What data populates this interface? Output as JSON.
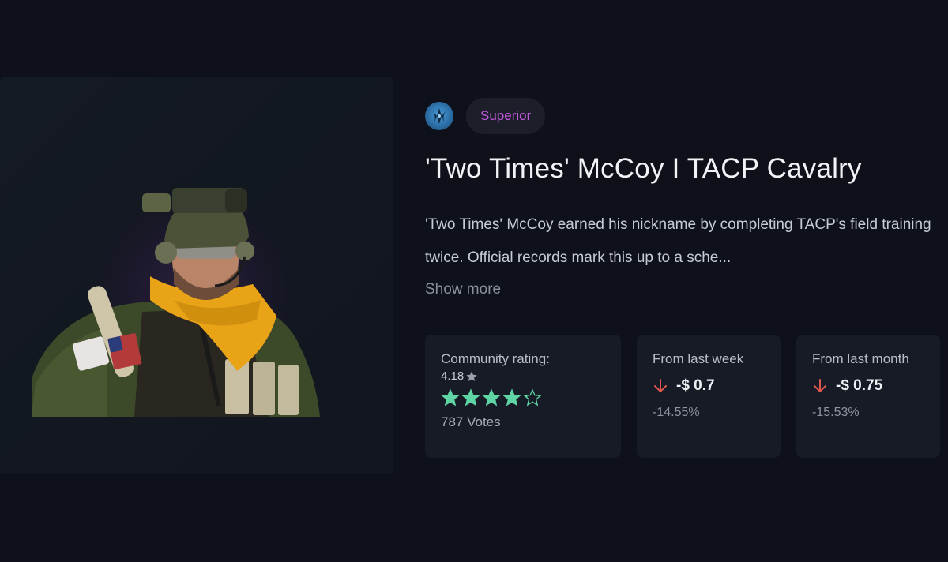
{
  "item": {
    "rarity": "Superior",
    "name": "'Two Times' McCoy I TACP Cavalry",
    "description": "'Two Times' McCoy earned his nickname by completing TACP's field training twice. Official records mark this up to a sche...",
    "show_more_label": "Show more",
    "faction_icon": "faction-emblem-icon"
  },
  "stats": {
    "rating": {
      "label": "Community rating:",
      "score": "4.18",
      "stars_value": 4.18,
      "votes": "787 Votes"
    },
    "week": {
      "label": "From last week",
      "value": "-$ 0.7",
      "percent": "-14.55%"
    },
    "month": {
      "label": "From last month",
      "value": "-$ 0.75",
      "percent": "-15.53%"
    }
  },
  "colors": {
    "background": "#0f111a",
    "rarity": "#c658e0",
    "star": "#5fd4a4",
    "down_arrow": "#e0574f"
  }
}
